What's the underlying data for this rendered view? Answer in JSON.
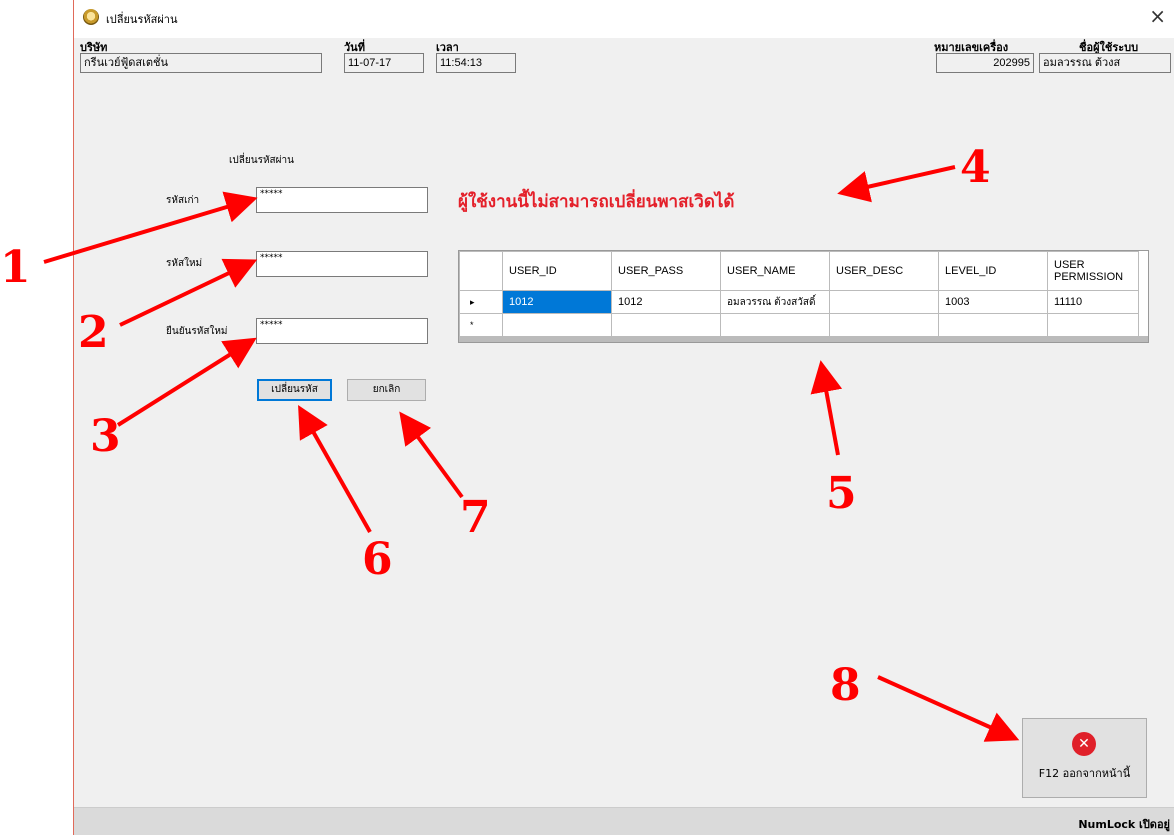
{
  "window": {
    "title": "เปลี่ยนรหัสผ่าน",
    "close": "×"
  },
  "header": {
    "company_label": "บริษัท",
    "company_value": "กรีนเวย์ฟู้ดสเตชั่น",
    "date_label": "วันที่",
    "date_value": "11-07-17",
    "time_label": "เวลา",
    "time_value": "11:54:13",
    "machine_label": "หมายเลขเครื่อง",
    "machine_value": "202995",
    "user_label": "ชื่อผู้ใช้ระบบ",
    "user_value": "อมลวรรณ ต้วงส"
  },
  "form": {
    "section_title": "เปลี่ยนรหัสผ่าน",
    "old_label": "รหัสเก่า",
    "old_value": "*****",
    "new_label": "รหัสใหม่",
    "new_value": "*****",
    "confirm_label": "ยืนยันรหัสใหม่",
    "confirm_value": "*****",
    "change_button": "เปลี่ยนรหัส",
    "cancel_button": "ยกเลิก"
  },
  "error_message": "ผู้ใช้งานนี้ไม่สามารถเปลี่ยนพาสเวิดได้",
  "grid": {
    "columns": [
      "USER_ID",
      "USER_PASS",
      "USER_NAME",
      "USER_DESC",
      "LEVEL_ID",
      "USER\nPERMISSION"
    ],
    "rows": [
      [
        "1012",
        "1012",
        "อมลวรรณ ต้วงสวัสดิ์",
        "",
        "1003",
        "11110"
      ]
    ],
    "current_row_marker": "▸",
    "new_row_marker": "*"
  },
  "exit_button": {
    "label": "F12 ออกจากหน้านี้",
    "icon": "close-circle-icon"
  },
  "status_bar": {
    "numlock": "NumLock เปิดอยู่"
  },
  "annotations": {
    "labels": [
      "1",
      "2",
      "3",
      "4",
      "5",
      "6",
      "7",
      "8"
    ],
    "color": "#ff0000"
  }
}
